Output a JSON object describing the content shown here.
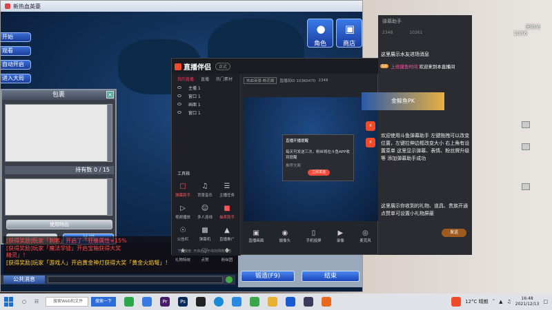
{
  "game": {
    "title": "新热血英豪",
    "side_buttons": [
      "开始",
      "观看",
      "自动开启",
      "进入大局"
    ],
    "bag": {
      "title": "包裹",
      "count_label": "持有数",
      "count_value": "0 / 15",
      "bar_label": "使用物品",
      "btn_left": "丢弃",
      "btn_close": "关闭"
    },
    "panel": {
      "character": "角色",
      "shop": "商店"
    },
    "chat": {
      "line1": "[获得奖励]玩家「刺客」开启了「狂暴属性+15%",
      "line2": "[获得奖励]玩家「魔法学徒」开启宝箱获得大奖",
      "line3": "精灵」！",
      "line4": "[获得奖励]玩家「游戏人」开启黄金神灯获得大奖「黄金火焰弩」！",
      "channel": "公共消息"
    },
    "buttons": {
      "forge": "锻造(F9)",
      "end": "结束"
    }
  },
  "stream": {
    "logo": "直播伴侣",
    "version": "正式",
    "tabs": [
      "我的直播",
      "直播",
      "热门素材"
    ],
    "scenes": [
      "主播 1",
      "窗口 1",
      "画面 1",
      "窗口 1"
    ],
    "tools_title": "工具箱",
    "tools": [
      "弹幕助手",
      "背景音乐",
      "主播任务",
      "视频播放",
      "多人连线",
      "抽奖助手",
      "公告栏",
      "弹幕机",
      "直播推广",
      "礼物特效",
      "点赞",
      "粉丝团"
    ],
    "info_title": "热血英豪·桃花阁",
    "info_id": "直播间ID 10360470",
    "info_viewers": "2348",
    "popup": {
      "title": "直播开播提醒",
      "body": "每天可发送三次，粉丝将在斗鱼APP收到提醒",
      "sub": "推荐文案",
      "button": "立即发送"
    },
    "bottom": [
      "直播画面",
      "摄像头",
      "手机投屏",
      "录像",
      "麦克风"
    ],
    "status": "下载速度: 开启后显示你的网络状态"
  },
  "overlay": {
    "title": "弹幕助手",
    "stats": [
      "2348",
      "10361"
    ],
    "msg1": "这里展示水友进场消息",
    "badge": "Lv",
    "user": "上班摸鱼时间",
    "welcome": "欢迎来到本直播间",
    "gift_banner": "金鲸鱼PK",
    "text1": "欢迎使用斗鱼弹幕助手 左键拖拽可以改变位置，左键拉伸边框改变大小 右上角有设置菜单 这里显示弹幕、表情、粉丝牌升级等 添加弹幕助手成功",
    "text2": "这里展示你收到的礼物、道具、贵族开通 点赞单可设置小礼物屏蔽",
    "send": "发送"
  },
  "desktop": {
    "right_number": "1036",
    "right_label": "回收站"
  },
  "taskbar": {
    "search_placeholder": "搜索Web和文件",
    "button": "搜索一下",
    "weather": "12°C 晴朗",
    "time": "16:48",
    "date": "2021/12/13"
  }
}
